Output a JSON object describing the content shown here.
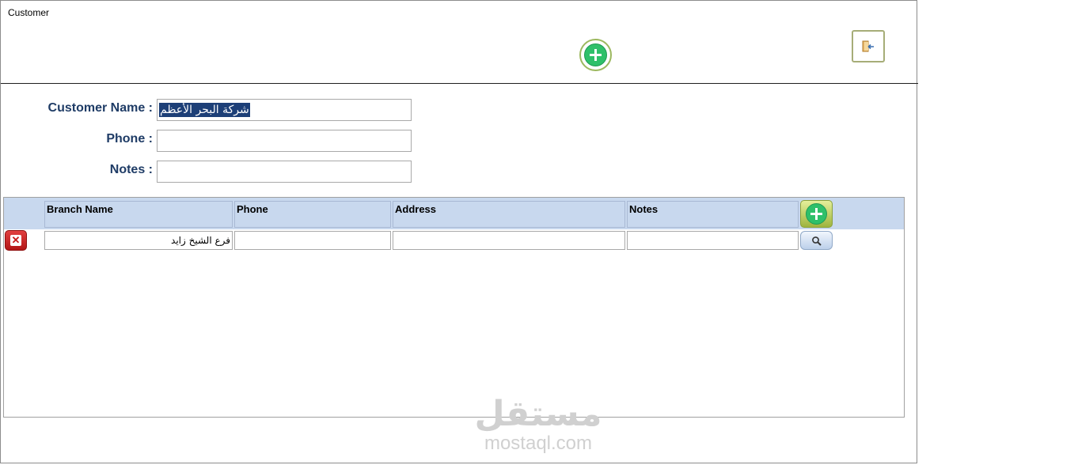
{
  "window": {
    "title": "Customer"
  },
  "toolbar": {
    "add_icon": "plus-circle-icon",
    "exit_icon": "exit-door-icon"
  },
  "form": {
    "customer_name_label": "Customer Name :",
    "customer_name_value": "شركة البحر الأعظم",
    "phone_label": "Phone :",
    "phone_value": "",
    "notes_label": "Notes :",
    "notes_value": ""
  },
  "branches": {
    "columns": [
      "Branch Name",
      "Phone",
      "Address",
      "Notes"
    ],
    "rows": [
      {
        "branch_name": "فرع الشيخ زايد",
        "phone": "",
        "address": "",
        "notes": ""
      }
    ]
  },
  "watermark": {
    "arabic": "مستقل",
    "latin": "mostaql.com"
  },
  "colors": {
    "label": "#1f3c66",
    "header_bg": "#c8d8ee",
    "selection": "#1d3f77",
    "add_green": "#2fc06a",
    "delete_red": "#c51a1a"
  }
}
